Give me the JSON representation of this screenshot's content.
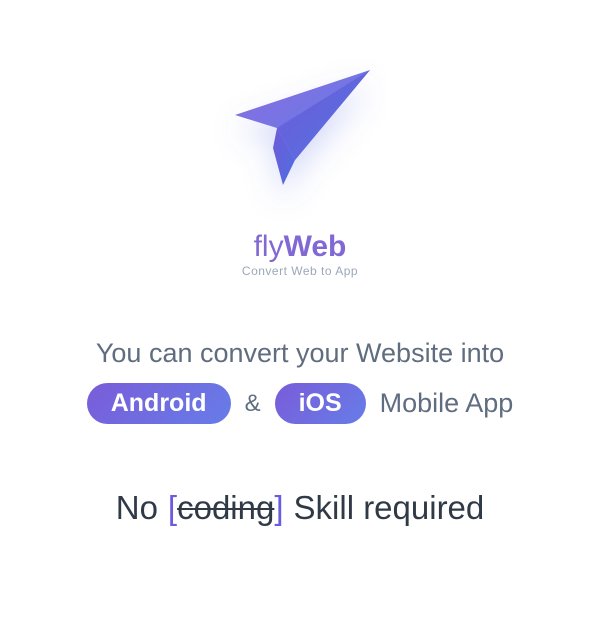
{
  "product": {
    "name_light": "fly",
    "name_bold": "Web",
    "tagline": "Convert Web to App"
  },
  "headline": {
    "line1": "You can convert your Website into",
    "android": "Android",
    "amp": "&",
    "ios": "iOS",
    "suffix": "Mobile App"
  },
  "subhead": {
    "prefix": "No",
    "bracket_open": "[",
    "strike_word": "coding",
    "bracket_close": "]",
    "suffix": "Skill required"
  }
}
